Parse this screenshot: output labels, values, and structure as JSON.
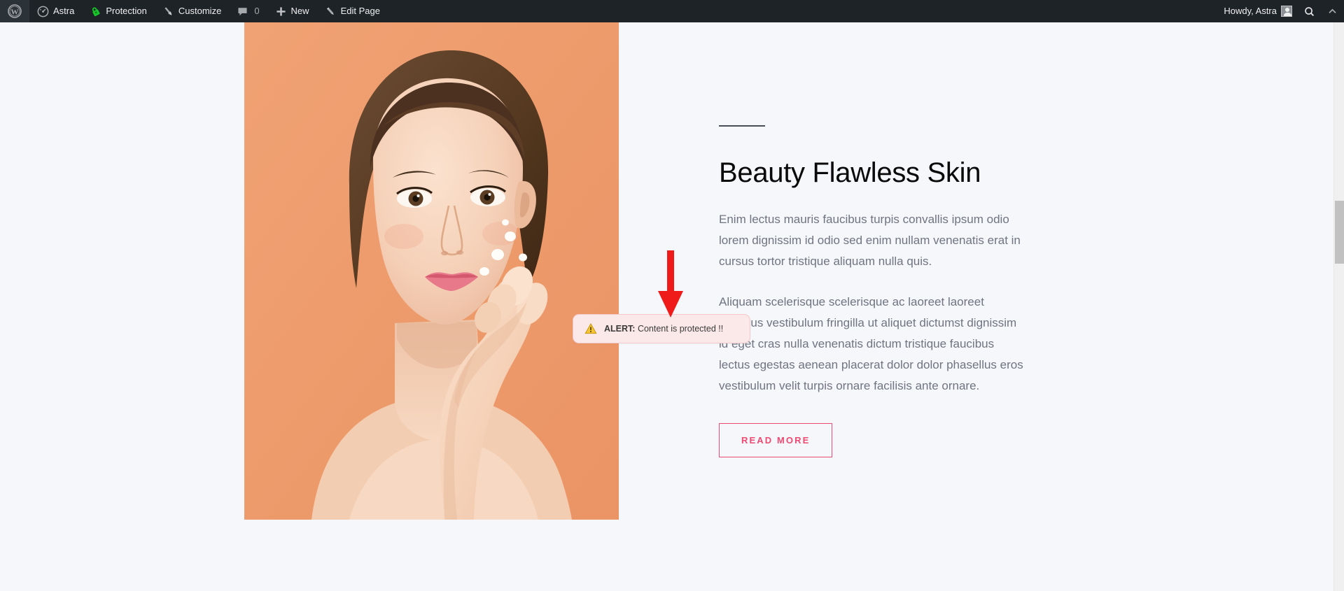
{
  "admin_bar": {
    "wp_logo_icon": "wordpress-logo-icon",
    "left_items": [
      {
        "label": "Astra",
        "icon": "dashboard-speedometer-icon",
        "name": "admin-bar-item-astra"
      },
      {
        "label": "Protection",
        "icon": "green-lock-shield-icon",
        "name": "admin-bar-item-protection"
      },
      {
        "label": "Customize",
        "icon": "paintbrush-icon",
        "name": "admin-bar-item-customize"
      },
      {
        "label": "0",
        "icon": "comment-bubble-icon",
        "name": "admin-bar-item-comments"
      },
      {
        "label": "New",
        "icon": "plus-icon",
        "name": "admin-bar-item-new"
      },
      {
        "label": "Edit Page",
        "icon": "pencil-icon",
        "name": "admin-bar-item-edit-page"
      }
    ],
    "right": {
      "howdy": "Howdy, Astra",
      "avatar_icon": "user-avatar-icon",
      "search_icon": "search-icon",
      "collapse_icon": "chevron-up-icon"
    }
  },
  "hero": {
    "divider": "",
    "title": "Beauty Flawless Skin",
    "paragraph_1": "Enim lectus mauris faucibus turpis convallis ipsum odio lorem dignissim id odio sed enim nullam venenatis erat in cursus tortor tristique aliquam nulla quis.",
    "paragraph_2": "Aliquam scelerisque scelerisque ac laoreet laoreet faucibus vestibulum fringilla ut aliquet dictumst dignissim id eget cras nulla venenatis dictum tristique faucibus lectus egestas aenean placerat dolor dolor phasellus eros vestibulum velit turpis ornare facilisis ante ornare.",
    "button_label": "READ MORE",
    "image_alt": "woman applying face cream on peach background"
  },
  "alert": {
    "icon": "warning-triangle-icon",
    "prefix": "ALERT:",
    "message": "Content is protected !!"
  },
  "annotation": {
    "arrow_icon": "red-down-arrow-icon"
  },
  "colors": {
    "admin_bar_bg": "#1d2327",
    "page_bg": "#f6f7fb",
    "accent_pink": "#ee4a72",
    "photo_bg": "#ee9c6d",
    "alert_bg": "#fbe8e8",
    "alert_border": "#f3c9c9",
    "arrow_red": "#ef1b1b",
    "body_text": "#6f7480",
    "heading_text": "#0a0a0a"
  },
  "scrollbar": {
    "thumb_top_pct": 31,
    "thumb_height_pct": 11
  }
}
